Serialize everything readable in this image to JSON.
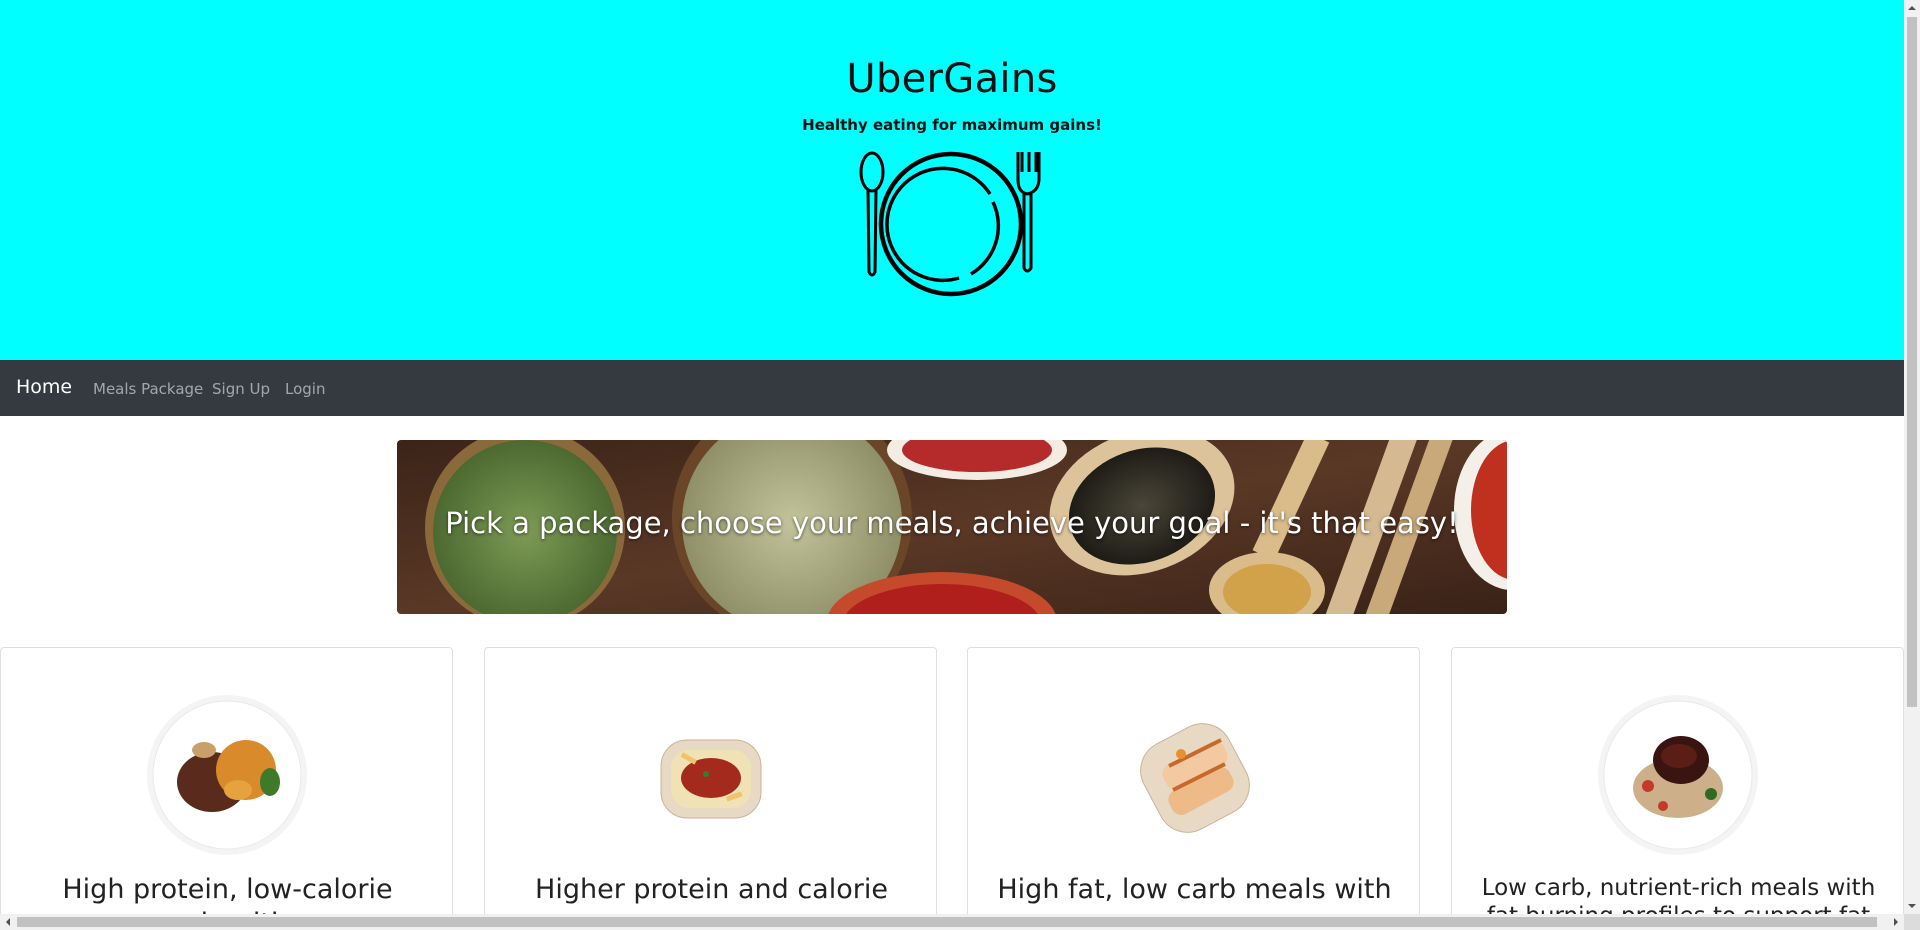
{
  "header": {
    "title": "UberGains",
    "tagline": "Healthy eating for maximum gains!",
    "logo_icon": "plate-cutlery-icon",
    "background_color": "#00ffff"
  },
  "navbar": {
    "brand": "Home",
    "links": [
      "Meals Package",
      "Sign Up",
      "Login"
    ],
    "background_color": "#343a40"
  },
  "banner": {
    "text": "Pick a package, choose your meals, achieve your goal - it's that easy!",
    "image": "spices-photo"
  },
  "cards": [
    {
      "title": "High protein, low-calorie meals with...",
      "image": "beef-sweet-potato-bowl-photo"
    },
    {
      "title": "Higher protein and calorie",
      "image": "penne-bolognese-container-photo"
    },
    {
      "title": "High fat, low carb meals with",
      "image": "grilled-wrap-container-photo"
    },
    {
      "title": "Low carb, nutrient-rich meals with fat burning profiles to support fat",
      "image": "glazed-meat-grain-bowl-photo"
    }
  ]
}
